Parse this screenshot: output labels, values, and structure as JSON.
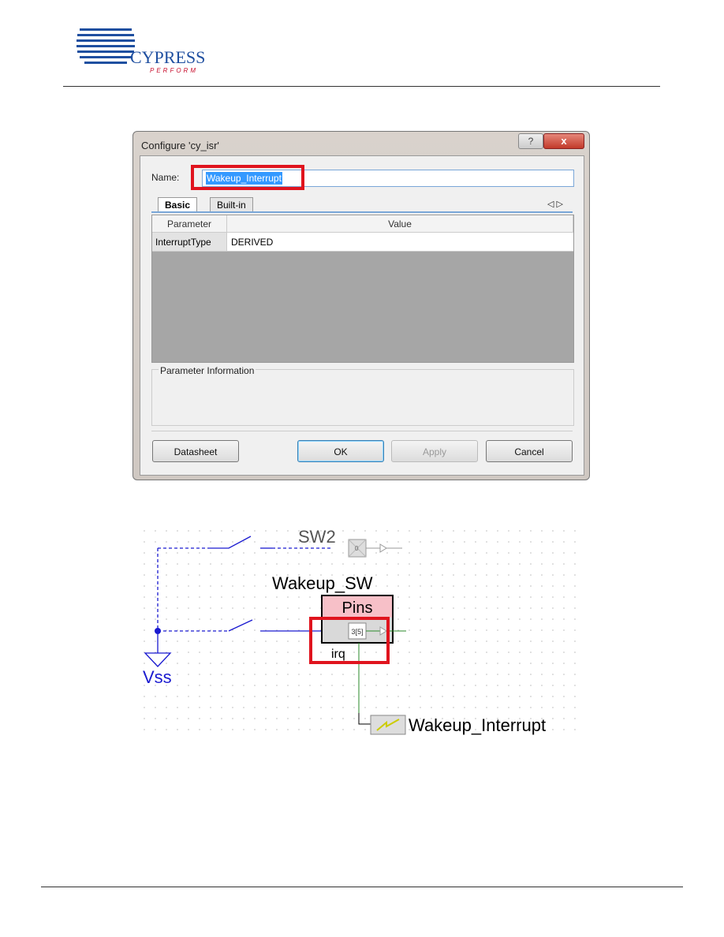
{
  "header": {
    "logo_text": "CYPRESS",
    "logo_tagline": "PERFORM"
  },
  "dialog": {
    "title": "Configure 'cy_isr'",
    "help_label": "?",
    "close_label": "x",
    "name_label": "Name:",
    "name_value": "Wakeup_Interrupt",
    "tabs": [
      {
        "label": "Basic",
        "active": true
      },
      {
        "label": "Built-in",
        "active": false
      }
    ],
    "scroll_arrows": "◁ ▷",
    "columns": [
      "Parameter",
      "Value"
    ],
    "rows": [
      {
        "parameter": "InterruptType",
        "value": "DERIVED"
      }
    ],
    "info_label": "Parameter Information",
    "buttons": {
      "datasheet": "Datasheet",
      "ok": "OK",
      "apply": "Apply",
      "cancel": "Cancel"
    }
  },
  "schematic": {
    "sw2_label": "SW2",
    "sw2_pin_value": "0",
    "component_name": "Wakeup_SW",
    "component_type": "Pins",
    "pin_value": "3[5]",
    "irq_label": "irq",
    "ground_label": "Vss",
    "isr_label": "Wakeup_Interrupt",
    "highlight_color": "#e0141e",
    "wire_blue": "#1a1ad0",
    "wire_green": "#2a8a2a"
  }
}
